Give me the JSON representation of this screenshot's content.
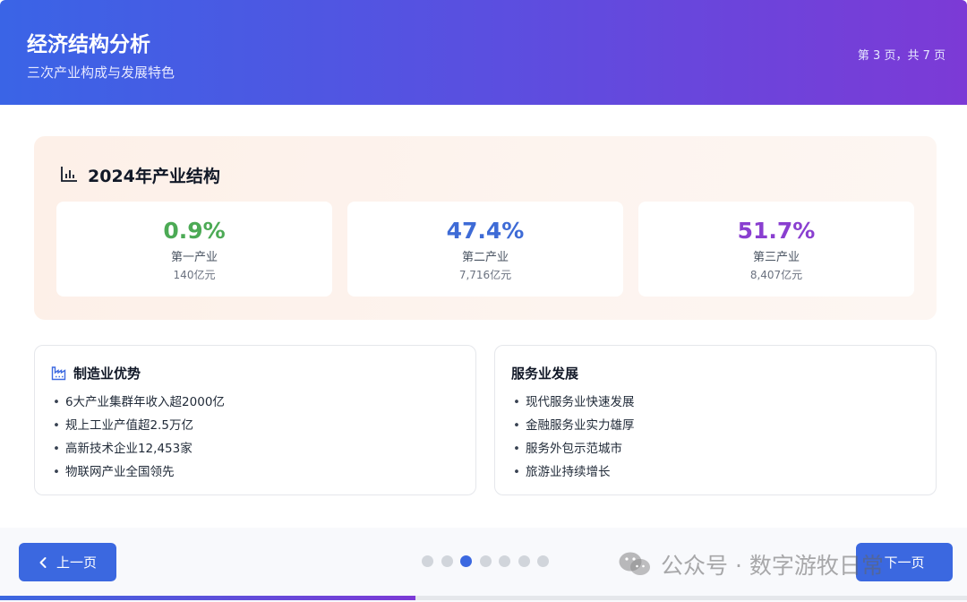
{
  "header": {
    "title": "经济结构分析",
    "subtitle": "三次产业构成与发展特色",
    "page_indicator": "第 3 页，共 7 页"
  },
  "structure": {
    "title": "2024年产业结构",
    "icon": "bar-chart-icon",
    "stats": [
      {
        "percent": "0.9%",
        "label": "第一产业",
        "value": "140亿元",
        "color": "#4caa55"
      },
      {
        "percent": "47.4%",
        "label": "第二产业",
        "value": "7,716亿元",
        "color": "#3e6bd6"
      },
      {
        "percent": "51.7%",
        "label": "第三产业",
        "value": "8,407亿元",
        "color": "#8a3fd0"
      }
    ]
  },
  "manufacturing": {
    "title": "制造业优势",
    "icon": "factory-icon",
    "items": [
      "6大产业集群年收入超2000亿",
      "规上工业产值超2.5万亿",
      "高新技术企业12,453家",
      "物联网产业全国领先"
    ]
  },
  "services": {
    "title": "服务业发展",
    "items": [
      "现代服务业快速发展",
      "金融服务业实力雄厚",
      "服务外包示范城市",
      "旅游业持续增长"
    ]
  },
  "nav": {
    "prev_label": "上一页",
    "next_label": "下一页",
    "total_pages": 7,
    "current_page": 3,
    "progress": 0.43
  },
  "watermark": {
    "text": "公众号 · 数字游牧日常",
    "icon": "wechat-icon"
  },
  "colors": {
    "accent": "#3b68e0",
    "header_start": "#3a64e6",
    "header_end": "#7c3ad6"
  }
}
